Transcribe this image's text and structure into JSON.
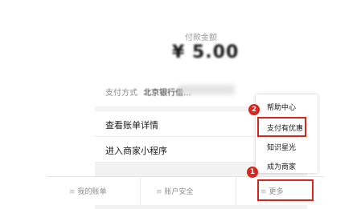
{
  "payment": {
    "amount_label": "付款金额",
    "amount_value": "¥ 5.00",
    "method_label": "支付方式",
    "method_value": "北京银行借..."
  },
  "rows": [
    {
      "label": "查看账单详情"
    },
    {
      "label": "进入商家小程序"
    }
  ],
  "tabs": [
    {
      "icon": "menu-icon",
      "label": "我的账单"
    },
    {
      "icon": "menu-icon",
      "label": "账户安全"
    },
    {
      "icon": "menu-icon",
      "label": "更多"
    }
  ],
  "popup_menu": {
    "items": [
      {
        "label": "帮助中心"
      },
      {
        "label": "支付有优惠"
      },
      {
        "label": "知识星光"
      },
      {
        "label": "成为商家"
      }
    ]
  },
  "annotations": {
    "badge_1": "1",
    "badge_2": "2",
    "color": "#d9251d"
  }
}
